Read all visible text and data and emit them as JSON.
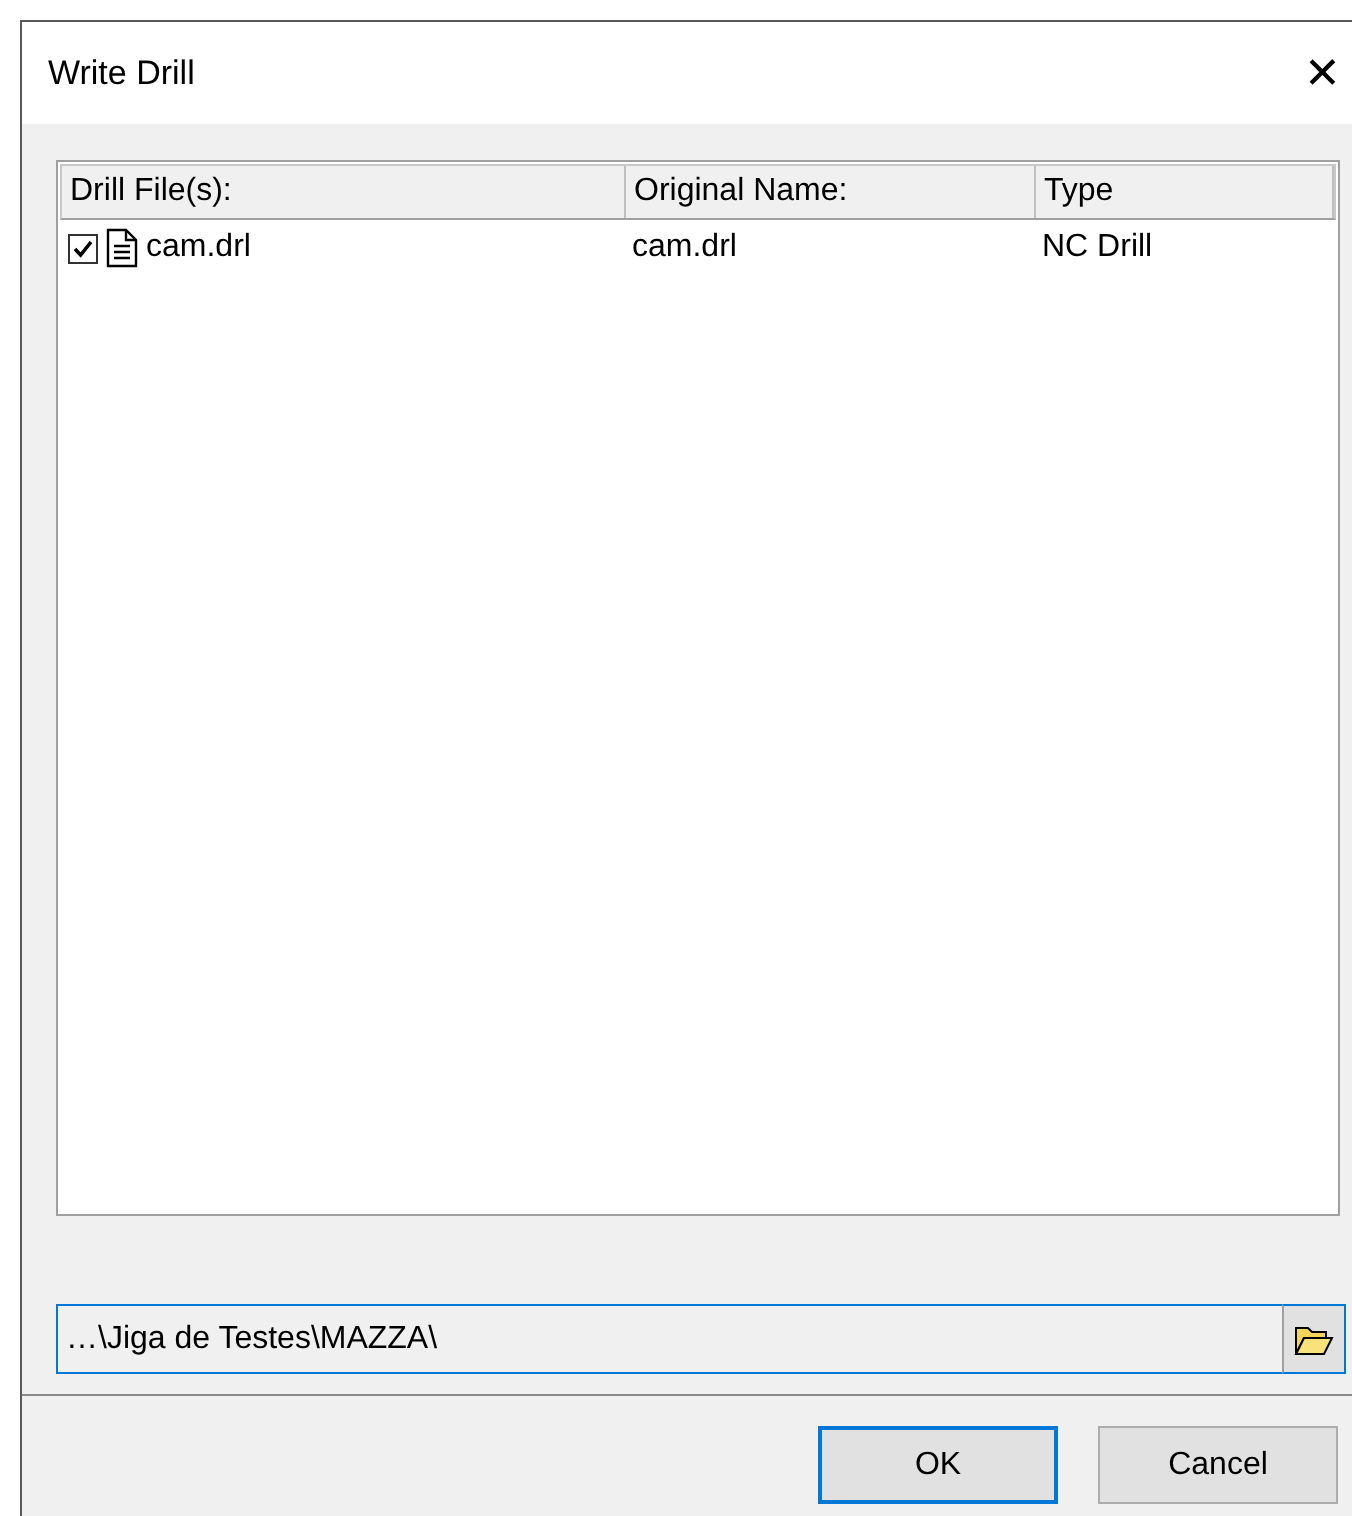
{
  "window": {
    "title": "Write Drill",
    "close": "✕"
  },
  "table": {
    "columns": [
      "Drill File(s):",
      "Original Name:",
      "Type"
    ],
    "rows": [
      {
        "checked": true,
        "file": "cam.drl",
        "original_name": "cam.drl",
        "type": "NC Drill"
      }
    ]
  },
  "path_field": {
    "value": "…\\Jiga de Testes\\MAZZA\\"
  },
  "buttons": [
    {
      "label": "OK",
      "default": true
    },
    {
      "label": "Cancel",
      "default": false
    }
  ]
}
